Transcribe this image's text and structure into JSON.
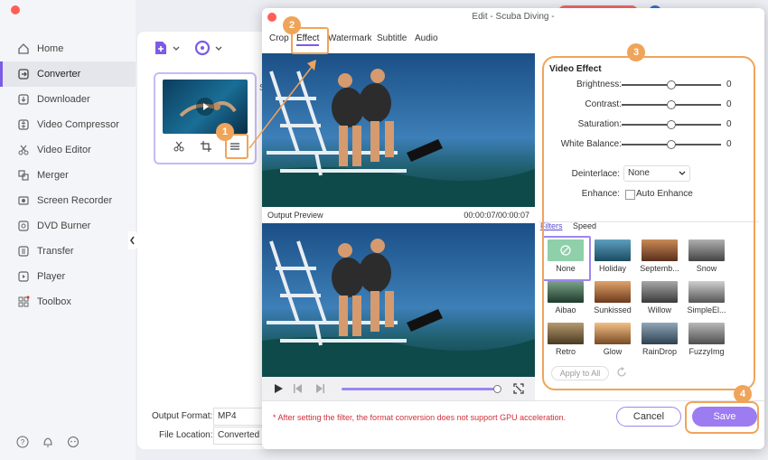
{
  "sidebar": {
    "items": [
      {
        "label": "Home",
        "icon": "home-icon"
      },
      {
        "label": "Converter",
        "icon": "converter-icon",
        "active": true
      },
      {
        "label": "Downloader",
        "icon": "downloader-icon"
      },
      {
        "label": "Video Compressor",
        "icon": "compress-icon"
      },
      {
        "label": "Video Editor",
        "icon": "scissors-icon"
      },
      {
        "label": "Merger",
        "icon": "merge-icon"
      },
      {
        "label": "Screen Recorder",
        "icon": "record-icon"
      },
      {
        "label": "DVD Burner",
        "icon": "disc-icon"
      },
      {
        "label": "Transfer",
        "icon": "transfer-icon"
      },
      {
        "label": "Player",
        "icon": "player-icon"
      },
      {
        "label": "Toolbox",
        "icon": "toolbox-icon"
      }
    ]
  },
  "main": {
    "output_format_label": "Output Format:",
    "output_format_value": "MP4",
    "file_location_label": "File Location:",
    "file_location_value": "Converted"
  },
  "dialog": {
    "title": "Edit - Scuba Diving -",
    "tabs": [
      "Crop",
      "Effect",
      "Watermark",
      "Subtitle",
      "Audio"
    ],
    "output_preview_label": "Output Preview",
    "time": "00:00:07/00:00:07",
    "video_effect_title": "Video Effect",
    "sliders": [
      {
        "label": "Brightness:",
        "value": "0"
      },
      {
        "label": "Contrast:",
        "value": "0"
      },
      {
        "label": "Saturation:",
        "value": "0"
      },
      {
        "label": "White Balance:",
        "value": "0"
      }
    ],
    "deinterlace_label": "Deinterlace:",
    "deinterlace_value": "None",
    "enhance_label": "Enhance:",
    "auto_enhance_label": "Auto Enhance",
    "filter_tabs": [
      "Filters",
      "Speed"
    ],
    "filters": [
      "None",
      "Holiday",
      "Septemb...",
      "Snow",
      "Aibao",
      "Sunkissed",
      "Willow",
      "SimpleEl...",
      "Retro",
      "Glow",
      "RainDrop",
      "FuzzyImg"
    ],
    "apply_all": "Apply to All",
    "note": "* After setting the filter, the format conversion does not support GPU acceleration.",
    "cancel": "Cancel",
    "save": "Save"
  },
  "annotations": [
    "1",
    "2",
    "3",
    "4"
  ],
  "colors": {
    "accent": "#7b5ce6",
    "annotation": "#f0a45a",
    "note_red": "#d0303a"
  }
}
